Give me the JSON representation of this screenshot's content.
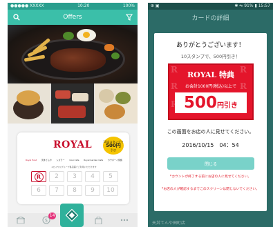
{
  "left_screen": {
    "status_bar": {
      "carrier": "●●●●● XXXXX",
      "time": "10:20",
      "battery": "100%"
    },
    "header": {
      "title": "Offers",
      "search_icon": "search-icon",
      "filter_icon": "filter-icon"
    },
    "stamp_card": {
      "brand": "ROYAL",
      "badge": {
        "line1": "10点スタンプで",
        "amount": "500円",
        "line3": "引き"
      },
      "participating_brands": [
        "Royal Host",
        "天丼てんや",
        "シズラー",
        "Cosi Cafe",
        "Royal Garden Cafe",
        "カウボーイ家族"
      ],
      "fine_print": "※ロイヤルグループ各店舗でご利用いただけます",
      "stamps": [
        {
          "label": "R",
          "stamped": true
        },
        {
          "label": "2",
          "stamped": false
        },
        {
          "label": "3",
          "stamped": false
        },
        {
          "label": "4",
          "stamped": false
        },
        {
          "label": "5",
          "stamped": false
        },
        {
          "label": "6",
          "stamped": false
        },
        {
          "label": "7",
          "stamped": false
        },
        {
          "label": "8",
          "stamped": false
        },
        {
          "label": "9",
          "stamped": false
        },
        {
          "label": "10",
          "stamped": false
        }
      ]
    },
    "bottom_nav": {
      "badge_count": "14"
    }
  },
  "right_screen": {
    "status_bar": {
      "signal": "⊕ ▣",
      "status": "✱ ⇋ 91% ▮ 15:57"
    },
    "header": {
      "title": "カードの詳細"
    },
    "dialog": {
      "thanks": "ありがとうございます！",
      "subtitle": "10スタンプで、500円引き！",
      "coupon": {
        "title": "ROYAL 特典",
        "condition": "お会計1000円(税込)以上で",
        "amount": "500",
        "unit": "円引き"
      },
      "instruction": "この画面をお店の人に見せてください。",
      "timestamp": "2016/10/15　04：54",
      "close_label": "閉じる",
      "warning_1": "*カウントが終了する前にお店の人に見せてください。",
      "warning_2": "*お店の人が確認するまでこのスクリーンは閉じないでください。"
    },
    "behind_text": "天丼てんや田町店"
  },
  "colors": {
    "teal": "#3bbfa9",
    "dark_teal": "#2c6b67",
    "royal_red": "#e4152b",
    "badge_yellow": "#f5c400",
    "close_button": "#79d2c9",
    "nav_badge": "#e4327a"
  }
}
